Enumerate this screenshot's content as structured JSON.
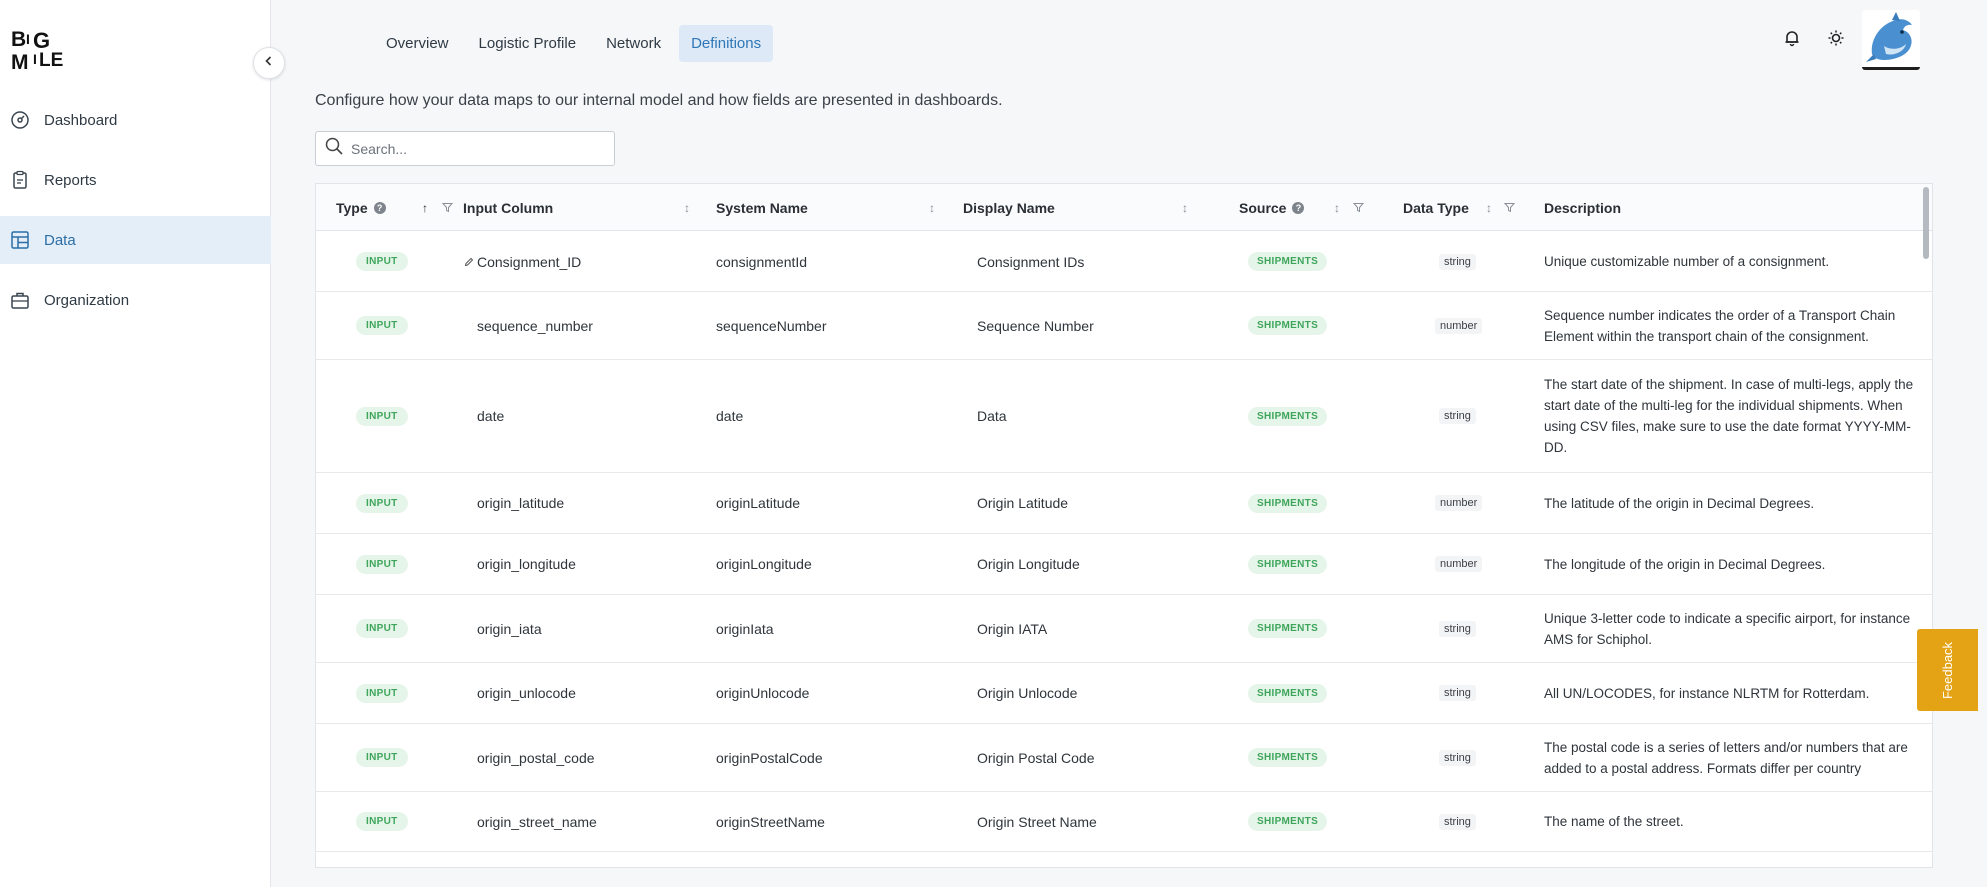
{
  "app": {
    "logo_text": "BIG MILE"
  },
  "sidebar": {
    "items": [
      {
        "label": "Dashboard",
        "icon": "dashboard-icon"
      },
      {
        "label": "Reports",
        "icon": "clipboard-icon"
      },
      {
        "label": "Data",
        "icon": "table-icon",
        "active": true
      },
      {
        "label": "Organization",
        "icon": "briefcase-icon"
      }
    ]
  },
  "tabs": [
    {
      "label": "Overview"
    },
    {
      "label": "Logistic Profile"
    },
    {
      "label": "Network"
    },
    {
      "label": "Definitions",
      "active": true
    }
  ],
  "intro": "Configure how your data maps to our internal model and how fields are presented in dashboards.",
  "search": {
    "placeholder": "Search..."
  },
  "table": {
    "headers": {
      "type": "Type",
      "input_column": "Input Column",
      "system_name": "System Name",
      "display_name": "Display Name",
      "source": "Source",
      "data_type": "Data Type",
      "description": "Description"
    },
    "rows": [
      {
        "type": "INPUT",
        "input_column": "Consignment_ID",
        "edited": true,
        "system_name": "consignmentId",
        "display_name": "Consignment IDs",
        "source": "SHIPMENTS",
        "data_type": "string",
        "description": "Unique customizable number of a consignment."
      },
      {
        "type": "INPUT",
        "input_column": "sequence_number",
        "system_name": "sequenceNumber",
        "display_name": "Sequence Number",
        "source": "SHIPMENTS",
        "data_type": "number",
        "description": "Sequence number indicates the order of a Transport Chain Element within the transport chain of the consignment."
      },
      {
        "type": "INPUT",
        "input_column": "date",
        "system_name": "date",
        "display_name": "Data",
        "source": "SHIPMENTS",
        "data_type": "string",
        "description": "The start date of the shipment. In case of multi-legs, apply the start date of the multi-leg for the individual shipments. When using CSV files, make sure to use the date format YYYY-MM-DD."
      },
      {
        "type": "INPUT",
        "input_column": "origin_latitude",
        "system_name": "originLatitude",
        "display_name": "Origin Latitude",
        "source": "SHIPMENTS",
        "data_type": "number",
        "description": "The latitude of the origin in Decimal Degrees."
      },
      {
        "type": "INPUT",
        "input_column": "origin_longitude",
        "system_name": "originLongitude",
        "display_name": "Origin Longitude",
        "source": "SHIPMENTS",
        "data_type": "number",
        "description": "The longitude of the origin in Decimal Degrees."
      },
      {
        "type": "INPUT",
        "input_column": "origin_iata",
        "system_name": "originIata",
        "display_name": "Origin IATA",
        "source": "SHIPMENTS",
        "data_type": "string",
        "description": "Unique 3-letter code to indicate a specific airport, for instance AMS for Schiphol."
      },
      {
        "type": "INPUT",
        "input_column": "origin_unlocode",
        "system_name": "originUnlocode",
        "display_name": "Origin Unlocode",
        "source": "SHIPMENTS",
        "data_type": "string",
        "description": "All UN/LOCODES, for instance NLRTM for Rotterdam."
      },
      {
        "type": "INPUT",
        "input_column": "origin_postal_code",
        "system_name": "originPostalCode",
        "display_name": "Origin Postal Code",
        "source": "SHIPMENTS",
        "data_type": "string",
        "description": "The postal code is a series of letters and/or numbers that are added to a postal address. Formats differ per country"
      },
      {
        "type": "INPUT",
        "input_column": "origin_street_name",
        "system_name": "originStreetName",
        "display_name": "Origin Street Name",
        "source": "SHIPMENTS",
        "data_type": "string",
        "description": "The name of the street."
      }
    ]
  },
  "feedback": {
    "label": "Feedback"
  },
  "colors": {
    "accent": "#2f77b7",
    "active_nav_bg": "#e4eef8",
    "badge_green": "#3ea55b",
    "feedback": "#e4a215"
  }
}
